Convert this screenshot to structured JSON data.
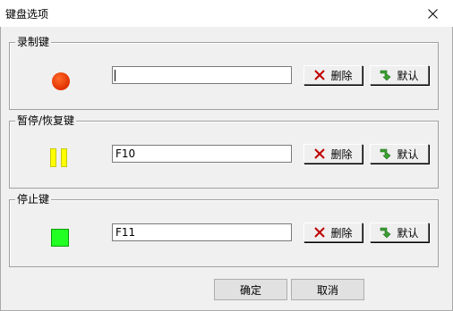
{
  "window": {
    "title": "键盘选项"
  },
  "groups": [
    {
      "legend": "录制键",
      "value": "",
      "delete_label": "删除",
      "default_label": "默认",
      "icon": "record-dot-icon",
      "icon_color": "#ff4500"
    },
    {
      "legend": "暂停/恢复键",
      "value": "F10",
      "delete_label": "删除",
      "default_label": "默认",
      "icon": "pause-icon",
      "icon_color": "#ffff00"
    },
    {
      "legend": "停止键",
      "value": "F11",
      "delete_label": "删除",
      "default_label": "默认",
      "icon": "stop-square-icon",
      "icon_color": "#22ff22"
    }
  ],
  "footer": {
    "ok_label": "确定",
    "cancel_label": "取消"
  },
  "colors": {
    "delete_x": "#c00000",
    "default_arrow": "#3aa030"
  }
}
